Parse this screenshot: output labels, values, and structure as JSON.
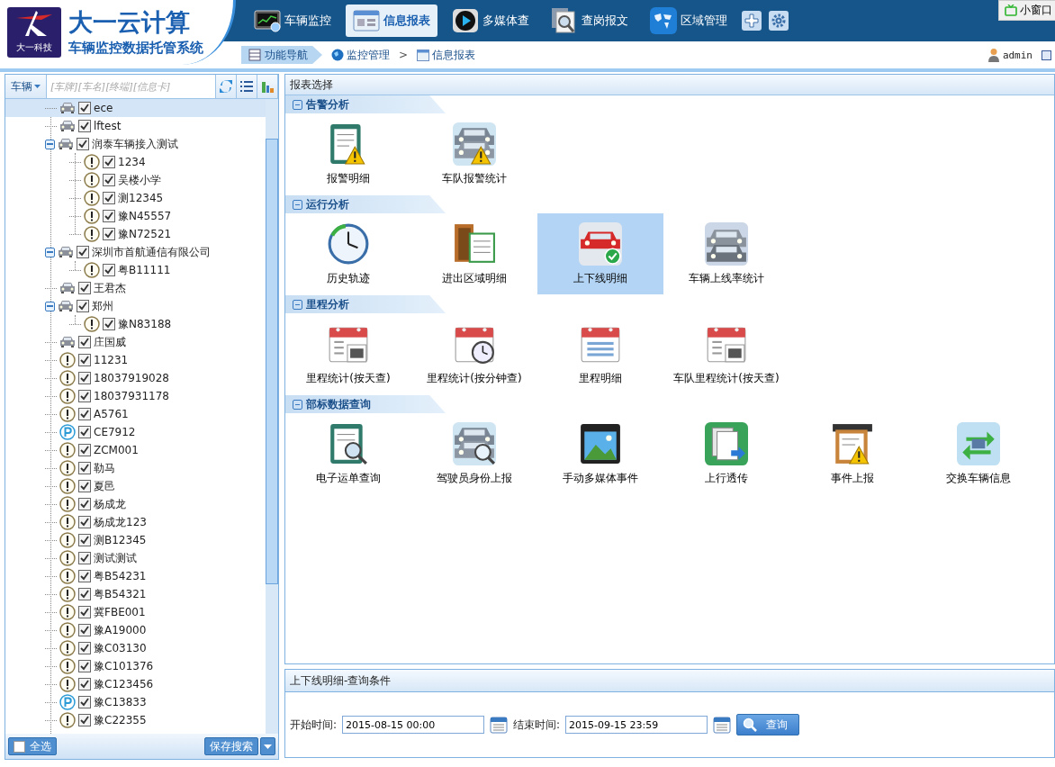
{
  "header": {
    "logo_title": "大一云计算",
    "logo_subtitle": "车辆监控数据托管系统",
    "logo_mark": "大一科技",
    "nav": [
      {
        "label": "车辆监控",
        "kind": "monitor",
        "selected": false
      },
      {
        "label": "信息报表",
        "kind": "window",
        "selected": true
      },
      {
        "label": "多媒体查",
        "kind": "play",
        "selected": false
      },
      {
        "label": "查岗报文",
        "kind": "magnifier",
        "selected": false
      },
      {
        "label": "区域管理",
        "kind": "globe",
        "selected": false
      }
    ],
    "mini_window": "小窗口"
  },
  "breadcrumb": {
    "nav_button": "功能导航",
    "items": [
      "监控管理",
      "信息报表"
    ],
    "separator": ">",
    "user": "admin"
  },
  "sidebar": {
    "filter_dropdown": "车辆",
    "search_placeholder": "[车牌][车名][终端][信息卡]",
    "tree": [
      {
        "label": "ece",
        "kind": "car",
        "checked": true,
        "selected": true
      },
      {
        "label": "lftest",
        "kind": "car",
        "checked": true,
        "selected": false
      },
      {
        "label": "润泰车辆接入测试",
        "kind": "car",
        "checked": true,
        "selected": false,
        "expanded": true,
        "children": [
          {
            "label": "1234",
            "kind": "alert",
            "checked": true,
            "selected": false
          },
          {
            "label": "吴楼小学",
            "kind": "alert",
            "checked": true,
            "selected": false
          },
          {
            "label": "测12345",
            "kind": "alert",
            "checked": true,
            "selected": false
          },
          {
            "label": "豫N45557",
            "kind": "alert",
            "checked": true,
            "selected": false
          },
          {
            "label": "豫N72521",
            "kind": "alert",
            "checked": true,
            "selected": false
          }
        ]
      },
      {
        "label": "深圳市首航通信有限公司",
        "kind": "car",
        "checked": true,
        "selected": false,
        "expanded": true,
        "children": [
          {
            "label": "粤B11111",
            "kind": "alert",
            "checked": true,
            "selected": false
          }
        ]
      },
      {
        "label": "王君杰",
        "kind": "car",
        "checked": true,
        "selected": false
      },
      {
        "label": "郑州",
        "kind": "car",
        "checked": true,
        "selected": false,
        "expanded": true,
        "children": [
          {
            "label": "豫N83188",
            "kind": "alert",
            "checked": true,
            "selected": false
          }
        ]
      },
      {
        "label": "庄国威",
        "kind": "car",
        "checked": true,
        "selected": false
      },
      {
        "label": "11231",
        "kind": "alert",
        "checked": true,
        "selected": false
      },
      {
        "label": "18037919028",
        "kind": "alert",
        "checked": true,
        "selected": false
      },
      {
        "label": "18037931178",
        "kind": "alert",
        "checked": true,
        "selected": false
      },
      {
        "label": "A5761",
        "kind": "alert",
        "checked": true,
        "selected": false
      },
      {
        "label": "CE7912",
        "kind": "parking",
        "checked": true,
        "selected": false
      },
      {
        "label": "ZCM001",
        "kind": "alert",
        "checked": true,
        "selected": false
      },
      {
        "label": "勒马",
        "kind": "alert",
        "checked": true,
        "selected": false
      },
      {
        "label": "夏邑",
        "kind": "alert",
        "checked": true,
        "selected": false
      },
      {
        "label": "杨成龙",
        "kind": "alert",
        "checked": true,
        "selected": false
      },
      {
        "label": "杨成龙123",
        "kind": "alert",
        "checked": true,
        "selected": false
      },
      {
        "label": "测B12345",
        "kind": "alert",
        "checked": true,
        "selected": false
      },
      {
        "label": "测试测试",
        "kind": "alert",
        "checked": true,
        "selected": false
      },
      {
        "label": "粤B54231",
        "kind": "alert",
        "checked": true,
        "selected": false
      },
      {
        "label": "粤B54321",
        "kind": "alert",
        "checked": true,
        "selected": false
      },
      {
        "label": "冀FBE001",
        "kind": "alert",
        "checked": true,
        "selected": false
      },
      {
        "label": "豫A19000",
        "kind": "alert",
        "checked": true,
        "selected": false
      },
      {
        "label": "豫C03130",
        "kind": "alert",
        "checked": true,
        "selected": false
      },
      {
        "label": "豫C101376",
        "kind": "alert",
        "checked": true,
        "selected": false
      },
      {
        "label": "豫C123456",
        "kind": "alert",
        "checked": true,
        "selected": false
      },
      {
        "label": "豫C13833",
        "kind": "parking",
        "checked": true,
        "selected": false
      },
      {
        "label": "豫C22355",
        "kind": "alert",
        "checked": true,
        "selected": false
      }
    ],
    "select_all": {
      "label": "全选",
      "checked": false
    },
    "save_button": "保存搜索"
  },
  "reports": {
    "title": "报表选择",
    "sections": [
      {
        "title": "告警分析",
        "items": [
          {
            "label": "报警明细",
            "kind": "list-warning",
            "selected": false
          },
          {
            "label": "车队报警统计",
            "kind": "cars-warning",
            "selected": false
          }
        ]
      },
      {
        "title": "运行分析",
        "items": [
          {
            "label": "历史轨迹",
            "kind": "clock",
            "selected": false
          },
          {
            "label": "进出区域明细",
            "kind": "door",
            "selected": false
          },
          {
            "label": "上下线明细",
            "kind": "car-check",
            "selected": true
          },
          {
            "label": "车辆上线率统计",
            "kind": "cars",
            "selected": false
          }
        ]
      },
      {
        "title": "里程分析",
        "items": [
          {
            "label": "里程统计(按天查)",
            "kind": "calendar",
            "selected": false
          },
          {
            "label": "里程统计(按分钟查)",
            "kind": "calendar-clock",
            "selected": false
          },
          {
            "label": "里程明细",
            "kind": "calendar-list",
            "selected": false
          },
          {
            "label": "车队里程统计(按天查)",
            "kind": "calendar",
            "selected": false
          }
        ]
      },
      {
        "title": "部标数据查询",
        "items": [
          {
            "label": "电子运单查询",
            "kind": "doc-search",
            "selected": false
          },
          {
            "label": "驾驶员身份上报",
            "kind": "cars-search",
            "selected": false
          },
          {
            "label": "手动多媒体事件",
            "kind": "photo",
            "selected": false
          },
          {
            "label": "上行透传",
            "kind": "docs-arrow",
            "selected": false
          },
          {
            "label": "事件上报",
            "kind": "clipboard-warning",
            "selected": false
          },
          {
            "label": "交换车辆信息",
            "kind": "exchange",
            "selected": false
          }
        ]
      }
    ]
  },
  "query": {
    "title": "上下线明细-查询条件",
    "start_label": "开始时间:",
    "start_value": "2015-08-15 00:00",
    "end_label": "结束时间:",
    "end_value": "2015-09-15 23:59",
    "button": "查询"
  }
}
